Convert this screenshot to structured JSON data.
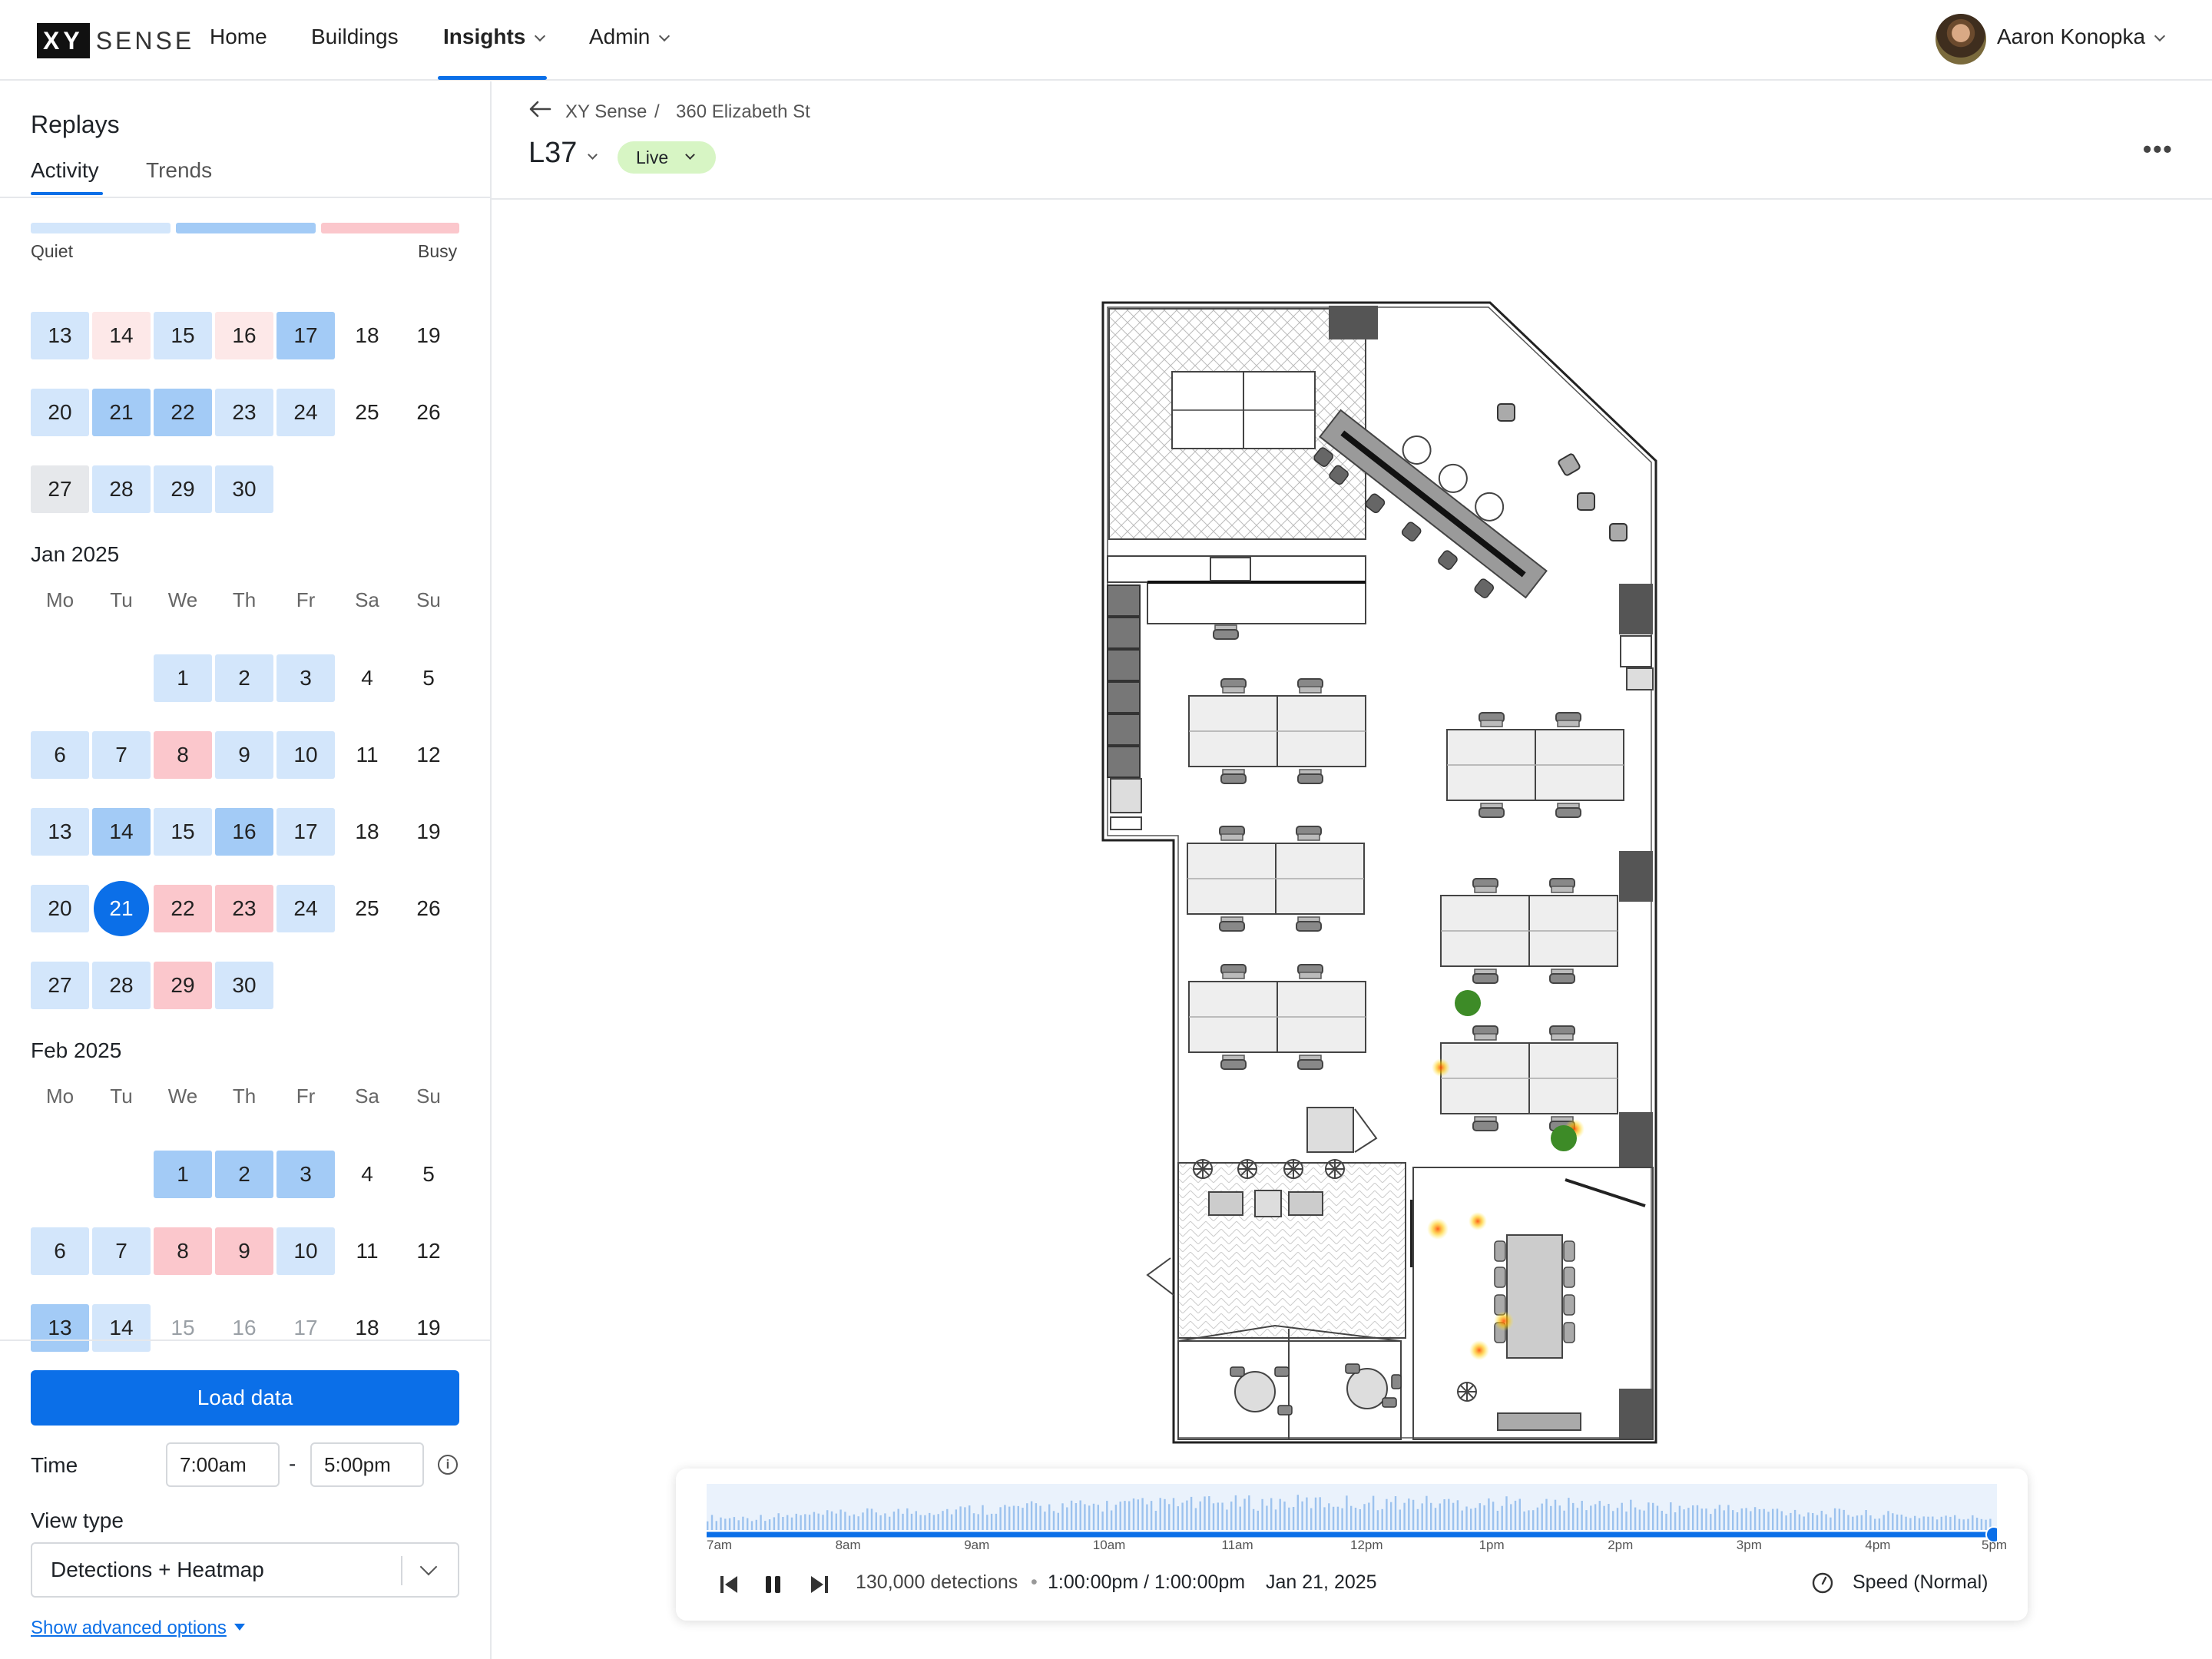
{
  "nav": {
    "logo_xy": "XY",
    "logo_sense": "SENSE",
    "links": [
      "Home",
      "Buildings",
      "Insights",
      "Admin"
    ],
    "user_name": "Aaron Konopka"
  },
  "sidebar": {
    "title": "Replays",
    "tabs": [
      "Activity",
      "Trends"
    ],
    "legend_quiet": "Quiet",
    "legend_busy": "Busy",
    "months": [
      {
        "title": "",
        "rows": [
          [
            [
              "13",
              "l1"
            ],
            [
              "14",
              "p1"
            ],
            [
              "15",
              "l1"
            ],
            [
              "16",
              "p1"
            ],
            [
              "17",
              "l2"
            ],
            [
              "18",
              ""
            ],
            [
              "19",
              ""
            ]
          ],
          [
            [
              "20",
              "l1"
            ],
            [
              "21",
              "l2"
            ],
            [
              "22",
              "l2"
            ],
            [
              "23",
              "l1"
            ],
            [
              "24",
              "l1"
            ],
            [
              "25",
              ""
            ],
            [
              "26",
              ""
            ]
          ],
          [
            [
              "27",
              "g"
            ],
            [
              "28",
              "l1"
            ],
            [
              "29",
              "l1"
            ],
            [
              "30",
              "l1"
            ]
          ]
        ]
      },
      {
        "title": "Jan 2025",
        "dow": [
          "Mo",
          "Tu",
          "We",
          "Th",
          "Fr",
          "Sa",
          "Su"
        ],
        "offset": 2,
        "rows": [
          [
            [
              "1",
              "l1"
            ],
            [
              "2",
              "l1"
            ],
            [
              "3",
              "l1"
            ],
            [
              "4",
              ""
            ],
            [
              "5",
              ""
            ]
          ],
          [
            [
              "6",
              "l1"
            ],
            [
              "7",
              "l1"
            ],
            [
              "8",
              "p2"
            ],
            [
              "9",
              "l1"
            ],
            [
              "10",
              "l1"
            ],
            [
              "11",
              ""
            ],
            [
              "12",
              ""
            ]
          ],
          [
            [
              "13",
              "l1"
            ],
            [
              "14",
              "l2"
            ],
            [
              "15",
              "l1"
            ],
            [
              "16",
              "l2"
            ],
            [
              "17",
              "l1"
            ],
            [
              "18",
              ""
            ],
            [
              "19",
              ""
            ]
          ],
          [
            [
              "20",
              "l1"
            ],
            [
              "21",
              "sel"
            ],
            [
              "22",
              "p2"
            ],
            [
              "23",
              "p2"
            ],
            [
              "24",
              "l1"
            ],
            [
              "25",
              ""
            ],
            [
              "26",
              ""
            ]
          ],
          [
            [
              "27",
              "l1"
            ],
            [
              "28",
              "l1"
            ],
            [
              "29",
              "p2"
            ],
            [
              "30",
              "l1"
            ]
          ]
        ]
      },
      {
        "title": "Feb 2025",
        "dow": [
          "Mo",
          "Tu",
          "We",
          "Th",
          "Fr",
          "Sa",
          "Su"
        ],
        "offset": 2,
        "rows": [
          [
            [
              "1",
              "l2"
            ],
            [
              "2",
              "l2"
            ],
            [
              "3",
              "l2"
            ],
            [
              "4",
              ""
            ],
            [
              "5",
              ""
            ]
          ],
          [
            [
              "6",
              "l1"
            ],
            [
              "7",
              "l1"
            ],
            [
              "8",
              "p2"
            ],
            [
              "9",
              "p2"
            ],
            [
              "10",
              "l1"
            ],
            [
              "11",
              ""
            ],
            [
              "12",
              ""
            ]
          ],
          [
            [
              "13",
              "l2"
            ],
            [
              "14",
              "l1"
            ],
            [
              "15",
              "fade"
            ],
            [
              "16",
              "fade"
            ],
            [
              "17",
              "fade"
            ],
            [
              "18",
              ""
            ],
            [
              "19",
              ""
            ]
          ]
        ]
      }
    ],
    "load_button": "Load data",
    "time_label": "Time",
    "time_start": "7:00am",
    "time_dash": "-",
    "time_end": "5:00pm",
    "view_type_label": "View type",
    "view_type_value": "Detections + Heatmap",
    "advanced_link": "Show advanced options"
  },
  "header": {
    "breadcrumb": [
      "XY Sense",
      "/",
      "360 Elizabeth St"
    ],
    "floor": "L37",
    "live_badge": "Live",
    "more": "•••"
  },
  "timeline": {
    "hours": [
      "7am",
      "8am",
      "9am",
      "10am",
      "11am",
      "12pm",
      "1pm",
      "2pm",
      "3pm",
      "4pm",
      "5pm"
    ],
    "detections": "130,000 detections",
    "dot": "•",
    "current_time": "1:00:00pm / 1:00:00pm",
    "date": "Jan 21, 2025",
    "speed": "Speed (Normal)",
    "progress": 1.0
  },
  "colors": {
    "accent": "#0b6fe8",
    "quiet_light": "#d3e6fb",
    "quiet": "#a3cbf6",
    "busy": "#fbc7cc",
    "live": "#d7f5c4"
  }
}
